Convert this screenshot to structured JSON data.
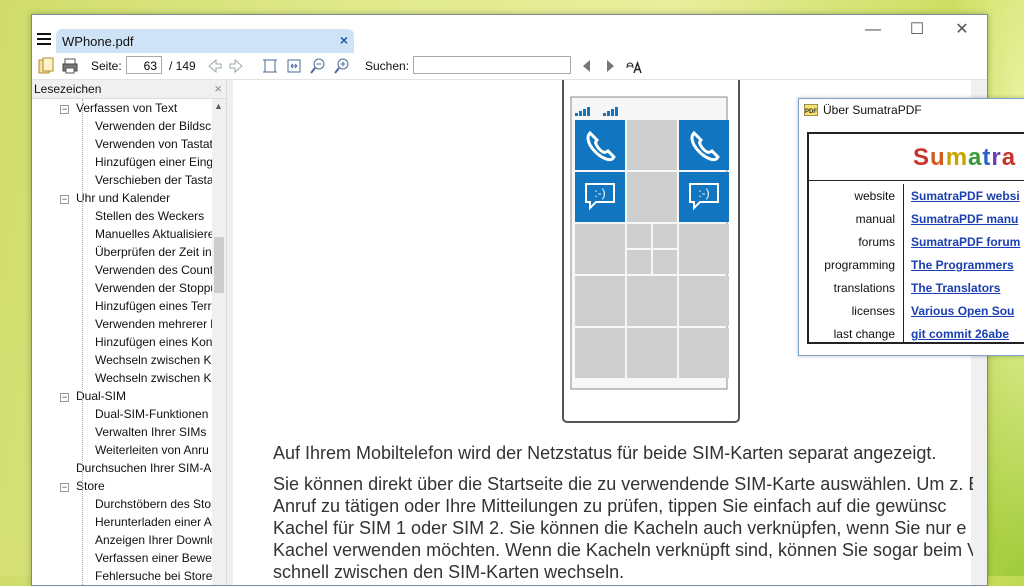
{
  "tab": {
    "title": "WPhone.pdf",
    "close": "×"
  },
  "window_controls": {
    "minimize": "—",
    "maximize": "☐",
    "close": "✕"
  },
  "toolbar": {
    "page_label": "Seite:",
    "page_current": "63",
    "page_total": "/ 149",
    "search_label": "Suchen:",
    "search_value": ""
  },
  "sidebar": {
    "title": "Lesezeichen",
    "close": "×",
    "items": [
      {
        "label": "Verfassen von Text",
        "level": 1,
        "expander": "−"
      },
      {
        "label": "Verwenden der Bildschi",
        "level": 2
      },
      {
        "label": "Verwenden von Tastat",
        "level": 2
      },
      {
        "label": "Hinzufügen einer Eing",
        "level": 2
      },
      {
        "label": "Verschieben der Tasta",
        "level": 2
      },
      {
        "label": "Uhr und Kalender",
        "level": 1,
        "expander": "−"
      },
      {
        "label": "Stellen des Weckers",
        "level": 2
      },
      {
        "label": "Manuelles Aktualisiere",
        "level": 2
      },
      {
        "label": "Überprüfen der Zeit in",
        "level": 2
      },
      {
        "label": "Verwenden des Count",
        "level": 2
      },
      {
        "label": "Verwenden der Stoppu",
        "level": 2
      },
      {
        "label": "Hinzufügen eines Terr",
        "level": 2
      },
      {
        "label": "Verwenden mehrerer l",
        "level": 2
      },
      {
        "label": "Hinzufügen eines Kon",
        "level": 2
      },
      {
        "label": "Wechseln zwischen Ka",
        "level": 2
      },
      {
        "label": "Wechseln zwischen Ka",
        "level": 2
      },
      {
        "label": "Dual-SIM",
        "level": 1,
        "expander": "−"
      },
      {
        "label": "Dual-SIM-Funktionen",
        "level": 2
      },
      {
        "label": "Verwalten Ihrer SIMs",
        "level": 2
      },
      {
        "label": "Weiterleiten von Anru",
        "level": 2
      },
      {
        "label": "Durchsuchen Ihrer SIM-A",
        "level": 1
      },
      {
        "label": "Store",
        "level": 1,
        "expander": "−"
      },
      {
        "label": "Durchstöbern des Stor",
        "level": 2
      },
      {
        "label": "Herunterladen einer A",
        "level": 2
      },
      {
        "label": "Anzeigen Ihrer Downlo",
        "level": 2
      },
      {
        "label": "Verfassen einer Bewer",
        "level": 2
      },
      {
        "label": "Fehlersuche bei Store",
        "level": 2
      }
    ]
  },
  "document": {
    "tile_emoticon": ":-)",
    "paragraph1": "Auf Ihrem Mobiltelefon wird der Netzstatus für beide SIM-Karten separat angezeigt.",
    "paragraph2": [
      "Sie können direkt über die Startseite die zu verwendende SIM-Karte auswählen. Um z. B",
      "Anruf zu tätigen oder Ihre Mitteilungen zu prüfen, tippen Sie einfach auf die gewünsc",
      "Kachel für SIM 1 oder SIM 2. Sie können die Kacheln auch verknüpfen, wenn Sie nur e",
      "Kachel verwenden möchten. Wenn die Kacheln verknüpft sind, können Sie sogar beim V",
      "schnell zwischen den SIM-Karten wechseln."
    ]
  },
  "about_dialog": {
    "title": "Über SumatraPDF",
    "icon_text": "PDF",
    "logo_text": "Sumatra",
    "rows": [
      {
        "label": "website",
        "link": "SumatraPDF websi"
      },
      {
        "label": "manual",
        "link": "SumatraPDF manu"
      },
      {
        "label": "forums",
        "link": "SumatraPDF forum"
      },
      {
        "label": "programming",
        "link": "The Programmers"
      },
      {
        "label": "translations",
        "link": "The Translators"
      },
      {
        "label": "licenses",
        "link": "Various Open Sou"
      },
      {
        "label": "last change",
        "link": "git commit 26abe"
      }
    ]
  },
  "colors": {
    "tile_blue": "#1175c0",
    "tile_gray": "#cfcfcf",
    "link": "#1a3fb0",
    "tab_bg": "#cfe3f7"
  }
}
